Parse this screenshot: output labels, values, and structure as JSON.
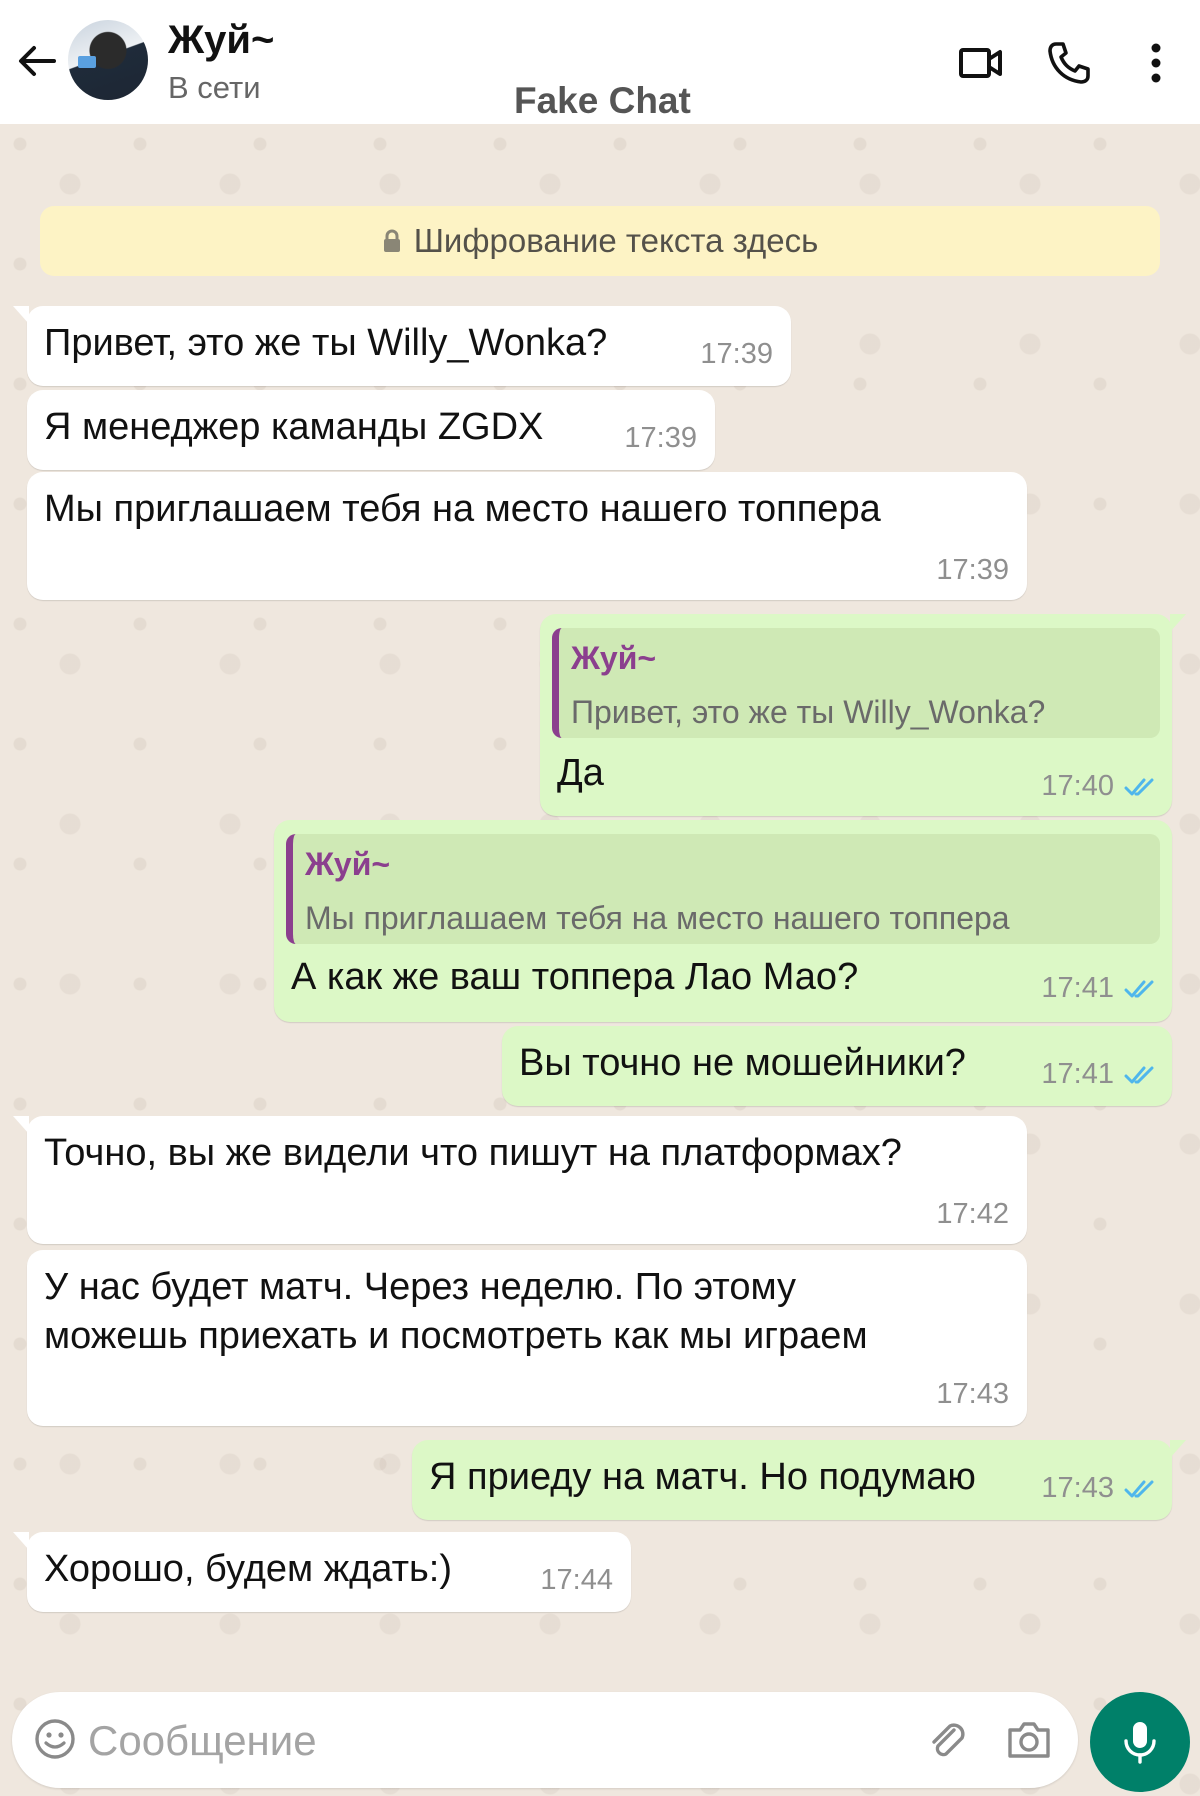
{
  "header": {
    "contact_name": "Жуй~",
    "status": "В сети",
    "watermark": "Fake Chat"
  },
  "notice": {
    "text": "Шифрование текста здесь"
  },
  "messages": [
    {
      "dir": "in",
      "text": "Привет, это же ты Willy_Wonka?",
      "time": "17:39"
    },
    {
      "dir": "in",
      "text": "Я менеджер каманды ZGDX",
      "time": "17:39"
    },
    {
      "dir": "in",
      "text": "Мы приглашаем тебя на место нашего топпера",
      "time": "17:39"
    },
    {
      "dir": "out",
      "quote_name": "Жуй~",
      "quote_text": "Привет, это же ты Willy_Wonka?",
      "text": "Да",
      "time": "17:40",
      "read": true
    },
    {
      "dir": "out",
      "quote_name": "Жуй~",
      "quote_text": "Мы приглашаем тебя на место нашего топпера",
      "text": "А как же ваш топпера Лао Мао?",
      "time": "17:41",
      "read": true
    },
    {
      "dir": "out",
      "text": "Вы точно не мошейники?",
      "time": "17:41",
      "read": true
    },
    {
      "dir": "in",
      "text": "Точно, вы же видели что пишут на платформах?",
      "time": "17:42"
    },
    {
      "dir": "in",
      "text_line1": "У нас будет матч. Через неделю. По этому",
      "text_line2": "можешь приехать и посмотреть как мы играем",
      "time": "17:43"
    },
    {
      "dir": "out",
      "text": "Я приеду на матч. Но подумаю",
      "time": "17:43",
      "read": true
    },
    {
      "dir": "in",
      "text": "Хорошо, будем ждать:)",
      "time": "17:44"
    }
  ],
  "composer": {
    "placeholder": "Сообщение"
  },
  "icons": {
    "back": "arrow-left-icon",
    "video": "video-call-icon",
    "call": "phone-icon",
    "menu": "more-vert-icon",
    "lock": "lock-icon",
    "read": "double-check-icon",
    "emoji": "emoji-icon",
    "attach": "paperclip-icon",
    "camera": "camera-icon",
    "mic": "microphone-icon"
  },
  "colors": {
    "header_bg": "#ffffff",
    "chat_bg": "#efe7de",
    "incoming_bubble": "#ffffff",
    "outgoing_bubble": "#dcf8c6",
    "quote_accent": "#8b3f8e",
    "read_ticks": "#4fb6ec",
    "accent_green": "#008069",
    "notice_bg": "#fdf3c5"
  }
}
